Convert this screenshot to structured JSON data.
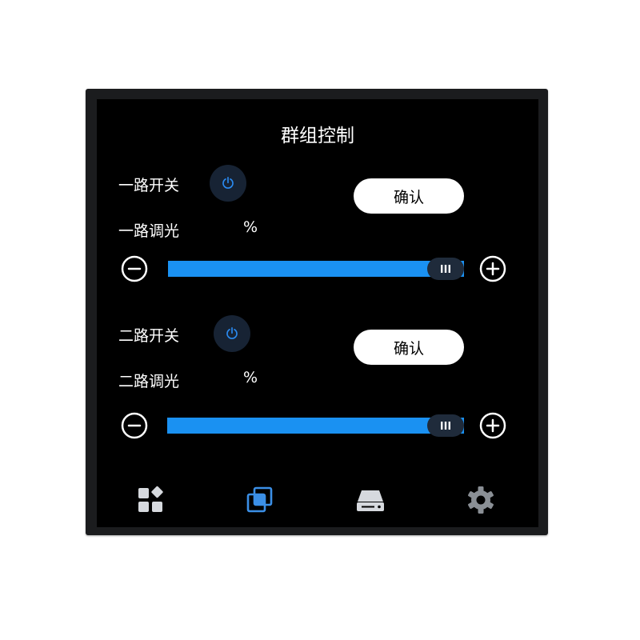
{
  "title": "群组控制",
  "channels": [
    {
      "switch_label": "一路开关",
      "dim_label": "一路调光",
      "percent_unit": "%",
      "confirm_label": "确认",
      "level": 1.0,
      "icons": {
        "power": "power-icon",
        "minus": "minus-circle-icon",
        "plus": "plus-circle-icon",
        "handle": "slider-handle-icon"
      }
    },
    {
      "switch_label": "二路开关",
      "dim_label": "二路调光",
      "percent_unit": "%",
      "confirm_label": "确认",
      "level": 1.0,
      "icons": {
        "power": "power-icon",
        "minus": "minus-circle-icon",
        "plus": "plus-circle-icon",
        "handle": "slider-handle-icon"
      }
    }
  ],
  "nav": [
    {
      "icon": "grid-apps-icon",
      "active": false
    },
    {
      "icon": "overlap-squares-icon",
      "active": true
    },
    {
      "icon": "storage-drive-icon",
      "active": false
    },
    {
      "icon": "settings-gear-icon",
      "active": false
    }
  ],
  "colors": {
    "accent": "#1a91f2",
    "power_icon": "#2a8bf2",
    "power_button_bg": "#172334",
    "nav_active": "#3b8fe6",
    "nav_inactive": "#d6d9de",
    "nav_gear": "#8a8f95",
    "screen_bg": "#000000",
    "bezel": "#1b1c1e"
  }
}
